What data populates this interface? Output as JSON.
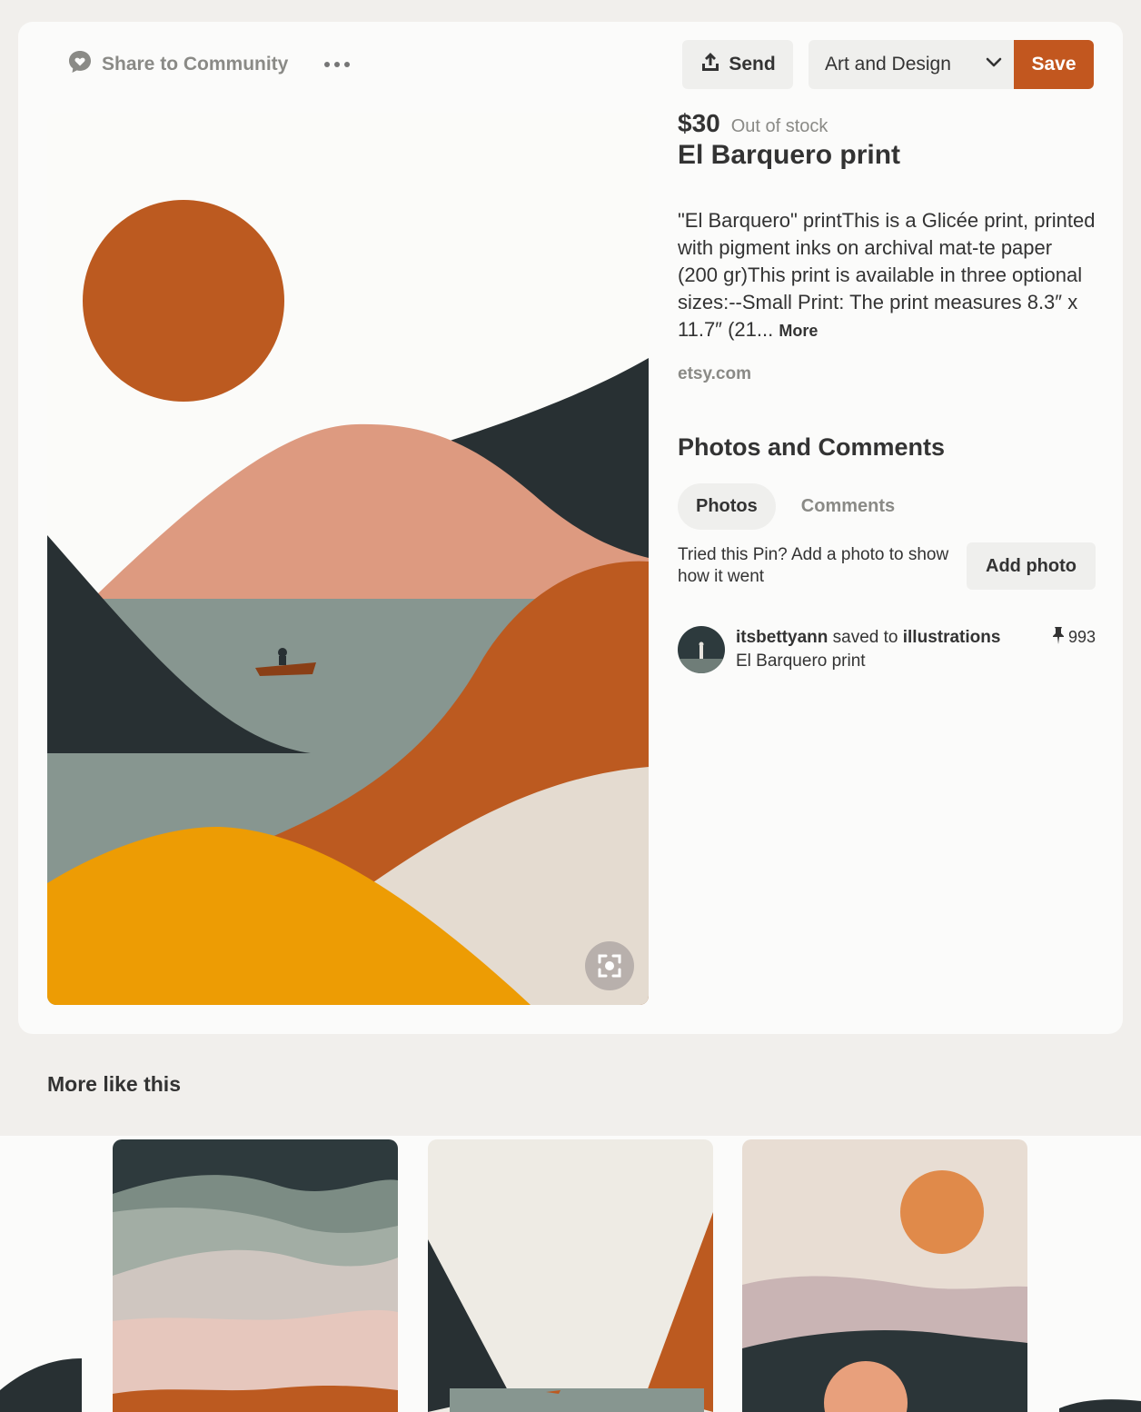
{
  "toolbar": {
    "share_label": "Share to Community",
    "more_options_icon": "ellipsis-icon",
    "send_label": "Send",
    "board_selected": "Art and Design",
    "save_label": "Save"
  },
  "pin": {
    "price": "$30",
    "stock_status": "Out of stock",
    "title": "El Barquero print",
    "description": "\"El Barquero\" printThis is a Glicée print, printed with pigment inks on archival mat-te paper (200 gr)This print is available in three optional sizes:--Small Print: The print measures 8.3″ x 11.7″ (21...",
    "more_label": "More",
    "source": "etsy.com"
  },
  "comments_section": {
    "title": "Photos and Comments",
    "tabs": [
      {
        "label": "Photos",
        "active": true
      },
      {
        "label": "Comments",
        "active": false
      }
    ],
    "tried_text": "Tried this Pin? Add a photo to show how it went",
    "add_photo_label": "Add photo"
  },
  "saver": {
    "username": "itsbettyann",
    "saved_to": "saved to",
    "board": "illustrations",
    "pin_title": "El Barquero print",
    "save_count": "993"
  },
  "more_like_this": {
    "title": "More like this"
  },
  "colors": {
    "accent": "#c2571f",
    "muted_text": "#8a8a86",
    "button_bg": "#efefed",
    "dark_teal": "#283033",
    "salmon": "#dd9a80",
    "sage": "#879690",
    "rust": "#bc5a20",
    "mustard": "#ed9c04",
    "cream": "#e4dbd0"
  }
}
